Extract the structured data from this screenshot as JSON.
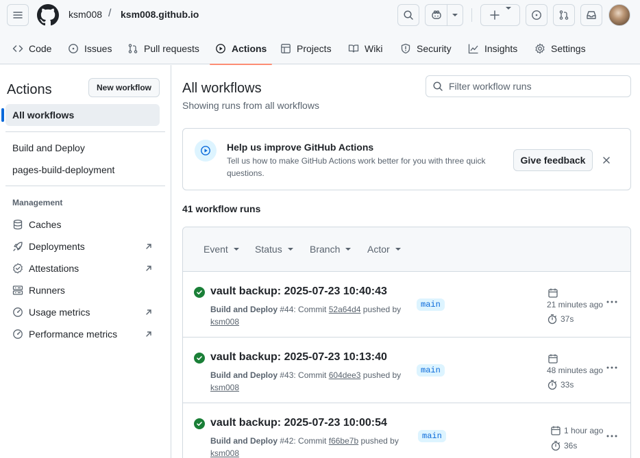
{
  "header": {
    "owner": "ksm008",
    "separator": "/",
    "repo": "ksm008.github.io"
  },
  "repo_nav": {
    "tabs": [
      {
        "label": "Code",
        "icon": "code-icon"
      },
      {
        "label": "Issues",
        "icon": "issue-opened-icon"
      },
      {
        "label": "Pull requests",
        "icon": "git-pull-request-icon"
      },
      {
        "label": "Actions",
        "icon": "play-icon",
        "active": true
      },
      {
        "label": "Projects",
        "icon": "table-icon"
      },
      {
        "label": "Wiki",
        "icon": "book-icon"
      },
      {
        "label": "Security",
        "icon": "shield-icon"
      },
      {
        "label": "Insights",
        "icon": "graph-icon"
      },
      {
        "label": "Settings",
        "icon": "gear-icon"
      }
    ]
  },
  "sidebar": {
    "title": "Actions",
    "new_workflow_label": "New workflow",
    "all_workflows_label": "All workflows",
    "workflows": [
      "Build and Deploy",
      "pages-build-deployment"
    ],
    "management_heading": "Management",
    "management_items": [
      {
        "label": "Caches",
        "icon": "database-icon",
        "external": false
      },
      {
        "label": "Deployments",
        "icon": "rocket-icon",
        "external": true
      },
      {
        "label": "Attestations",
        "icon": "verified-icon",
        "external": true
      },
      {
        "label": "Runners",
        "icon": "server-icon",
        "external": false
      },
      {
        "label": "Usage metrics",
        "icon": "meter-icon",
        "external": true
      },
      {
        "label": "Performance metrics",
        "icon": "meter-icon",
        "external": true
      }
    ]
  },
  "main": {
    "title": "All workflows",
    "subtitle": "Showing runs from all workflows",
    "filter_placeholder": "Filter workflow runs",
    "feedback": {
      "title": "Help us improve GitHub Actions",
      "body": "Tell us how to make GitHub Actions work better for you with three quick questions.",
      "button": "Give feedback"
    },
    "runs_count": "41 workflow runs",
    "filters": [
      "Event",
      "Status",
      "Branch",
      "Actor"
    ],
    "runs": [
      {
        "title": "vault backup: 2025-07-23 10:40:43",
        "workflow": "Build and Deploy",
        "number": "#44",
        "commit_prefix": ": Commit ",
        "commit": "52a64d4",
        "pushed_by": " pushed by",
        "actor": "ksm008",
        "branch": "main",
        "when": "21 minutes ago",
        "duration": "37s"
      },
      {
        "title": "vault backup: 2025-07-23 10:13:40",
        "workflow": "Build and Deploy",
        "number": "#43",
        "commit_prefix": ": Commit ",
        "commit": "604dee3",
        "pushed_by": " pushed by",
        "actor": "ksm008",
        "branch": "main",
        "when": "48 minutes ago",
        "duration": "33s"
      },
      {
        "title": "vault backup: 2025-07-23 10:00:54",
        "workflow": "Build and Deploy",
        "number": "#42",
        "commit_prefix": ": Commit ",
        "commit": "f66be7b",
        "pushed_by": " pushed by",
        "actor": "ksm008",
        "branch": "main",
        "when": "1 hour ago",
        "duration": "36s"
      }
    ]
  },
  "colors": {
    "accent": "#0969da",
    "success": "#1a7f37",
    "active_tab_underline": "#fd8c73",
    "branch_bg": "#ddf4ff"
  }
}
